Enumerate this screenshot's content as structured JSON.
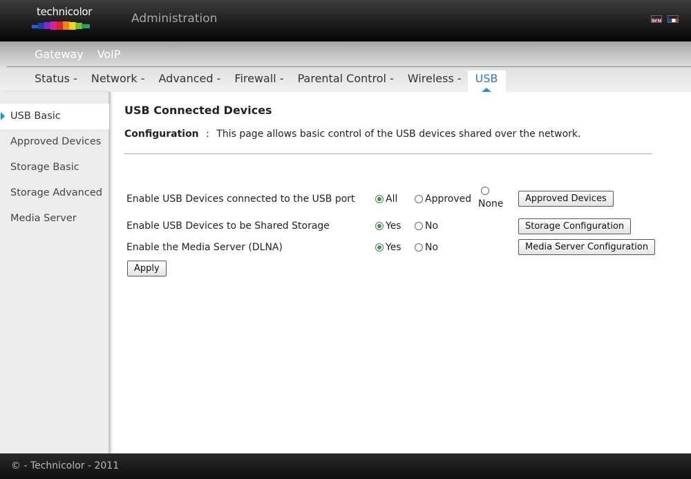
{
  "header": {
    "logo_text": "technicolor",
    "title": "Administration",
    "languages": [
      "english-flag-icon",
      "french-flag-icon"
    ]
  },
  "nav": {
    "main": [
      {
        "label": "Gateway"
      },
      {
        "label": "VoIP"
      }
    ],
    "tabs": [
      {
        "label": "Status -"
      },
      {
        "label": "Network -"
      },
      {
        "label": "Advanced -"
      },
      {
        "label": "Firewall -"
      },
      {
        "label": "Parental Control -"
      },
      {
        "label": "Wireless -"
      },
      {
        "label": "USB"
      }
    ],
    "active_tab": "USB"
  },
  "sidebar": {
    "items": [
      {
        "label": "USB Basic"
      },
      {
        "label": "Approved Devices"
      },
      {
        "label": "Storage Basic"
      },
      {
        "label": "Storage Advanced"
      },
      {
        "label": "Media Server"
      }
    ],
    "active_item": "USB Basic"
  },
  "main": {
    "title": "USB Connected Devices",
    "config_label": "Configuration",
    "config_sep": ":",
    "config_text": "This page allows basic control of the USB devices shared over the network.",
    "rows": [
      {
        "label": "Enable USB Devices connected to the USB port",
        "options": [
          {
            "label": "All",
            "selected": true
          },
          {
            "label": "Approved",
            "selected": false
          },
          {
            "label": "None",
            "selected": false
          }
        ],
        "button": "Approved Devices"
      },
      {
        "label": "Enable USB Devices to be Shared Storage",
        "options": [
          {
            "label": "Yes",
            "selected": true
          },
          {
            "label": "No",
            "selected": false
          }
        ],
        "button": "Storage Configuration"
      },
      {
        "label": "Enable the Media Server (DLNA)",
        "options": [
          {
            "label": "Yes",
            "selected": true
          },
          {
            "label": "No",
            "selected": false
          }
        ],
        "button": "Media Server Configuration"
      }
    ],
    "apply_label": "Apply"
  },
  "footer": {
    "text": "© - Technicolor - 2011"
  },
  "colors": {
    "accent": "#1e8fe6",
    "radio_selected": "#2fa232"
  }
}
